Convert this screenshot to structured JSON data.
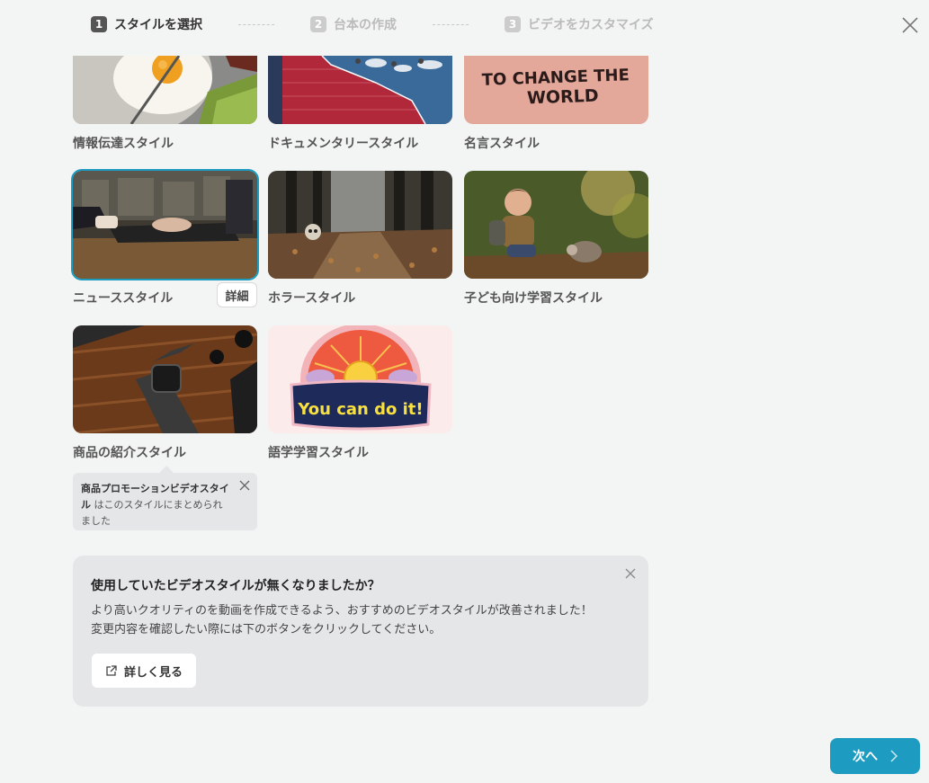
{
  "stepper": {
    "steps": [
      {
        "num": "1",
        "label": "スタイルを選択"
      },
      {
        "num": "2",
        "label": "台本の作成"
      },
      {
        "num": "3",
        "label": "ビデオをカスタマイズ"
      }
    ]
  },
  "styles": [
    {
      "label": "情報伝達スタイル",
      "icon": "fried-egg-image"
    },
    {
      "label": "ドキュメンタリースタイル",
      "icon": "documentary-chart-image"
    },
    {
      "label": "名言スタイル",
      "icon": "quote-image",
      "quote_text": "TO CHANGE THE WORLD"
    },
    {
      "label": "ニューススタイル",
      "icon": "laptop-hands-image",
      "selected": true,
      "detail_label": "詳細"
    },
    {
      "label": "ホラースタイル",
      "icon": "forest-skull-image"
    },
    {
      "label": "子ども向け学習スタイル",
      "icon": "boy-hedgehog-image"
    },
    {
      "label": "商品の紹介スタイル",
      "icon": "smartwatch-image"
    },
    {
      "label": "語学学習スタイル",
      "icon": "sunset-badge-image",
      "badge_text": "You can do it!"
    }
  ],
  "tooltip": {
    "bold": "商品プロモーションビデオスタイル",
    "rest": " はこのスタイルにまとめられました"
  },
  "notice": {
    "title": "使用していたビデオスタイルが無くなりましたか？",
    "line1": "より高いクオリティのを動画を作成できるよう、おすすめのビデオスタイルが改善されました！",
    "line2": "変更内容を確認したい際には下のボタンをクリックしてください。",
    "button": "詳しく見る"
  },
  "next_button": "次へ",
  "colors": {
    "accent": "#1e9bc1",
    "background": "#f3f4f4"
  }
}
